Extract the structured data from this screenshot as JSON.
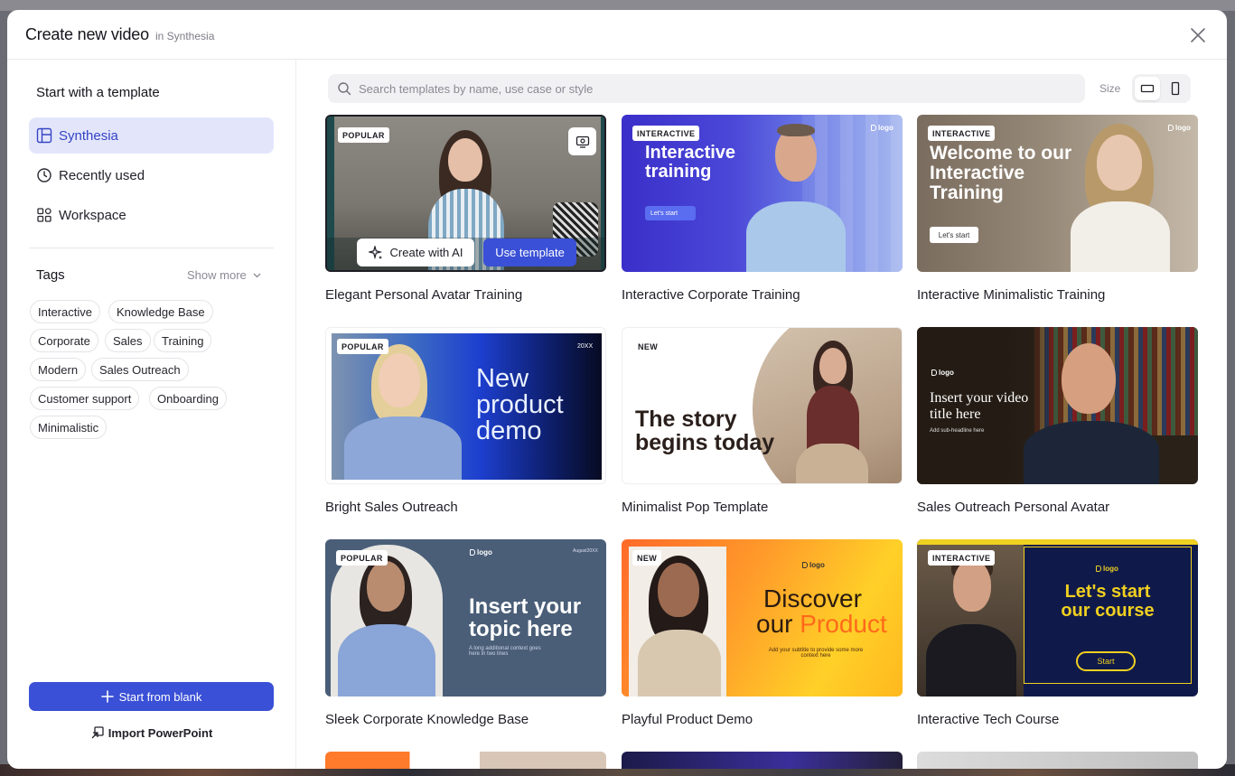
{
  "modal": {
    "title": "Create new video",
    "subtitle": "in Synthesia"
  },
  "sidebar": {
    "section_title": "Start with a template",
    "nav": [
      {
        "label": "Synthesia",
        "icon": "template-icon",
        "active": true
      },
      {
        "label": "Recently used",
        "icon": "clock-icon",
        "active": false
      },
      {
        "label": "Workspace",
        "icon": "grid-icon",
        "active": false
      }
    ],
    "tags_title": "Tags",
    "show_more": "Show more",
    "tags": [
      "Interactive",
      "Knowledge Base",
      "Corporate",
      "Sales",
      "Training",
      "Modern",
      "Sales Outreach",
      "Customer support",
      "Onboarding",
      "Minimalistic"
    ],
    "start_blank": "Start from blank",
    "import_ppt": "Import PowerPoint"
  },
  "search": {
    "placeholder": "Search templates by name, use case or style"
  },
  "size": {
    "label": "Size",
    "selected": "landscape"
  },
  "colors": {
    "accent": "#3a50d6",
    "active_nav_bg": "#e3e6fb"
  },
  "templates": [
    {
      "title": "Elegant Personal Avatar Training",
      "badge": "POPULAR",
      "hovered": true,
      "create_ai": "Create with AI",
      "use": "Use template"
    },
    {
      "title": "Interactive Corporate Training",
      "badge": "INTERACTIVE",
      "headline": "Interactive training",
      "cta": "Let's start",
      "logo": "logo"
    },
    {
      "title": "Interactive Minimalistic Training",
      "badge": "INTERACTIVE",
      "headline": "Welcome to our Interactive Training",
      "cta": "Let's start",
      "logo": "logo"
    },
    {
      "title": "Bright Sales Outreach",
      "badge": "POPULAR",
      "headline": "New product demo",
      "corner": "20XX"
    },
    {
      "title": "Minimalist Pop Template",
      "badge": "NEW",
      "headline": "The story begins today"
    },
    {
      "title": "Sales Outreach Personal Avatar",
      "headline": "Insert your video title here",
      "sub": "Add sub-headline here",
      "logo": "logo"
    },
    {
      "title": "Sleek Corporate Knowledge Base",
      "badge": "POPULAR",
      "headline": "Insert your topic here",
      "sub": "A long additional context goes here in two lines",
      "logo": "logo",
      "corner": "August20XX"
    },
    {
      "title": "Playful Product Demo",
      "badge": "NEW",
      "headline_a": "Discover",
      "headline_b": "our",
      "headline_c": "Product",
      "sub": "Add your subtitle to provide some more context here",
      "logo": "logo"
    },
    {
      "title": "Interactive Tech Course",
      "badge": "INTERACTIVE",
      "headline": "Let's start our course",
      "cta": "Start",
      "logo": "logo"
    }
  ]
}
